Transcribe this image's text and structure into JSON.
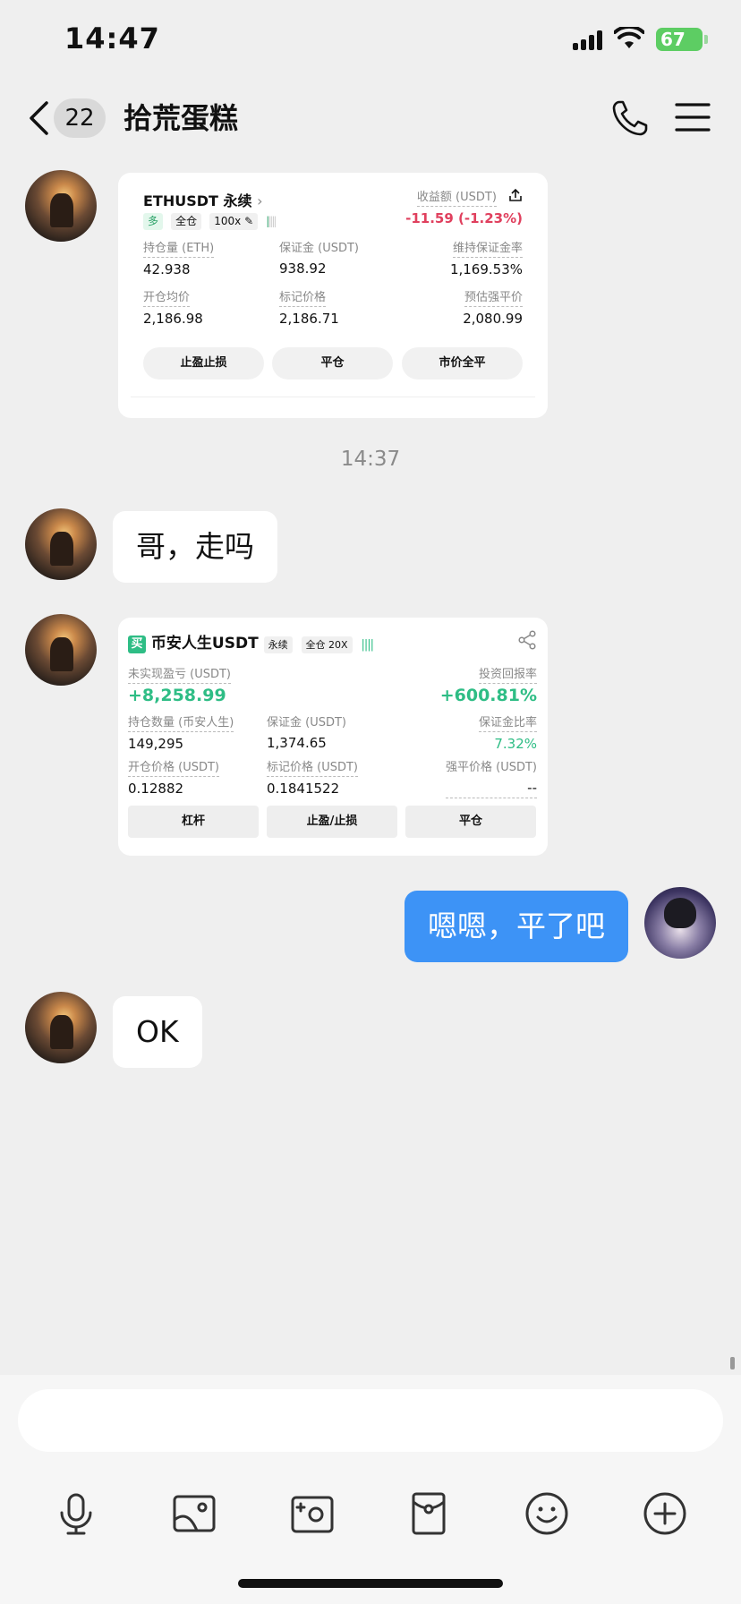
{
  "status_bar": {
    "time": "14:47",
    "battery": "67"
  },
  "header": {
    "unread_count": "22",
    "title": "拾荒蛋糕"
  },
  "messages": {
    "timestamp": "14:37",
    "text1": "哥，走吗",
    "text2": "嗯嗯，平了吧",
    "text3": "OK"
  },
  "card1": {
    "symbol": "ETHUSDT 永续",
    "tag_side": "多",
    "tag_margin": "全仓",
    "tag_leverage": "100x",
    "pnl_label": "收益额 (USDT)",
    "pnl_value": "-11.59 (-1.23%)",
    "fields": [
      {
        "label": "持仓量 (ETH)",
        "value": "42.938"
      },
      {
        "label": "保证金 (USDT)",
        "value": "938.92"
      },
      {
        "label": "维持保证金率",
        "value": "1,169.53%"
      },
      {
        "label": "开仓均价",
        "value": "2,186.98"
      },
      {
        "label": "标记价格",
        "value": "2,186.71"
      },
      {
        "label": "预估强平价",
        "value": "2,080.99"
      }
    ],
    "buttons": [
      "止盈止损",
      "平仓",
      "市价全平"
    ]
  },
  "card2": {
    "side_icon": "买",
    "symbol": "币安人生USDT",
    "tag_type": "永续",
    "tag_margin": "全仓 20X",
    "upnl_label": "未实现盈亏 (USDT)",
    "upnl_value": "+8,258.99",
    "roe_label": "投资回报率",
    "roe_value": "+600.81%",
    "fields": [
      {
        "label": "持仓数量 (币安人生)",
        "value": "149,295"
      },
      {
        "label": "保证金 (USDT)",
        "value": "1,374.65"
      },
      {
        "label": "保证金比率",
        "value": "7.32%"
      },
      {
        "label": "开仓价格 (USDT)",
        "value": "0.12882"
      },
      {
        "label": "标记价格 (USDT)",
        "value": "0.1841522"
      },
      {
        "label": "强平价格 (USDT)",
        "value": "--"
      }
    ],
    "buttons": [
      "杠杆",
      "止盈/止损",
      "平仓"
    ]
  },
  "colors": {
    "outgoing_bubble": "#3d93f6",
    "loss_red": "#e0405e",
    "profit_green": "#2ebd85"
  },
  "icons": {
    "header": [
      "back-icon",
      "phone-icon",
      "menu-icon"
    ],
    "toolbar": [
      "microphone-icon",
      "image-icon",
      "camera-icon",
      "red-packet-icon",
      "emoji-icon",
      "plus-icon"
    ]
  }
}
